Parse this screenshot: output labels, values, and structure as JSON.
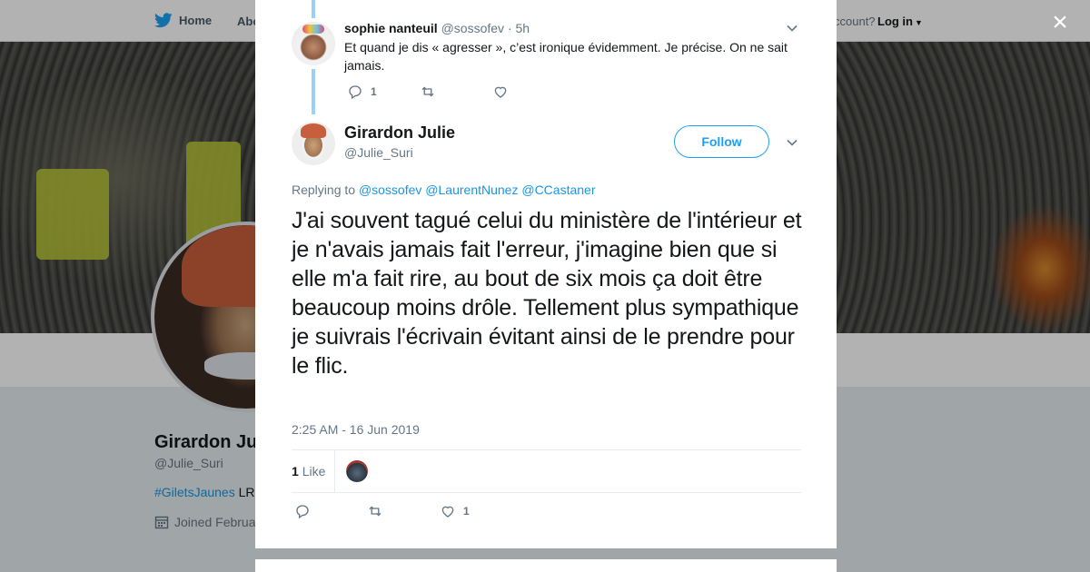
{
  "nav": {
    "home_label": "Home",
    "about_label": "Abo",
    "account_prompt": "ccount?",
    "login_label": "Log in"
  },
  "profile": {
    "name": "Girardon Ju",
    "handle": "@Julie_Suri",
    "bio_tag": "#GiletsJaunes",
    "bio_rest": " LR",
    "joined": "Joined Februa"
  },
  "modal": {
    "close_label": "×",
    "reply": {
      "author_name": "sophie nanteuil",
      "author_handle": "@sossofev",
      "time": "· 5h",
      "text": "Et quand je dis « agresser », c’est ironique évidemment. Je précise. On ne sait jamais.",
      "reply_count": "1",
      "retweet_count": "",
      "like_count": ""
    },
    "tweet": {
      "author_name": "Girardon Julie",
      "author_handle": "@Julie_Suri",
      "follow_label": "Follow",
      "replying_prefix": "Replying to",
      "replying_to": [
        "@sossofev",
        "@LaurentNunez",
        "@CCastaner"
      ],
      "text": "J'ai souvent tagué celui du ministère de l'intérieur et je n'avais jamais fait l'erreur, j'imagine bien que si elle m'a fait rire, au bout de six mois ça doit être beaucoup moins drôle. Tellement plus sympathique je suivrais l'écrivain évitant ainsi de le prendre pour le flic.",
      "timestamp": "2:25 AM - 16 Jun 2019",
      "likes_count": "1",
      "likes_label": "Like",
      "action_reply_count": "",
      "action_retweet_count": "",
      "action_like_count": "1"
    }
  },
  "colors": {
    "accent": "#1da1f2",
    "link": "#1b95e0",
    "muted": "#657786",
    "thread_line": "#9ad1f7"
  },
  "icons": [
    "twitter-bird-icon",
    "caret-down-icon",
    "close-icon",
    "chevron-down-icon",
    "reply-icon",
    "retweet-icon",
    "heart-icon",
    "calendar-icon"
  ]
}
